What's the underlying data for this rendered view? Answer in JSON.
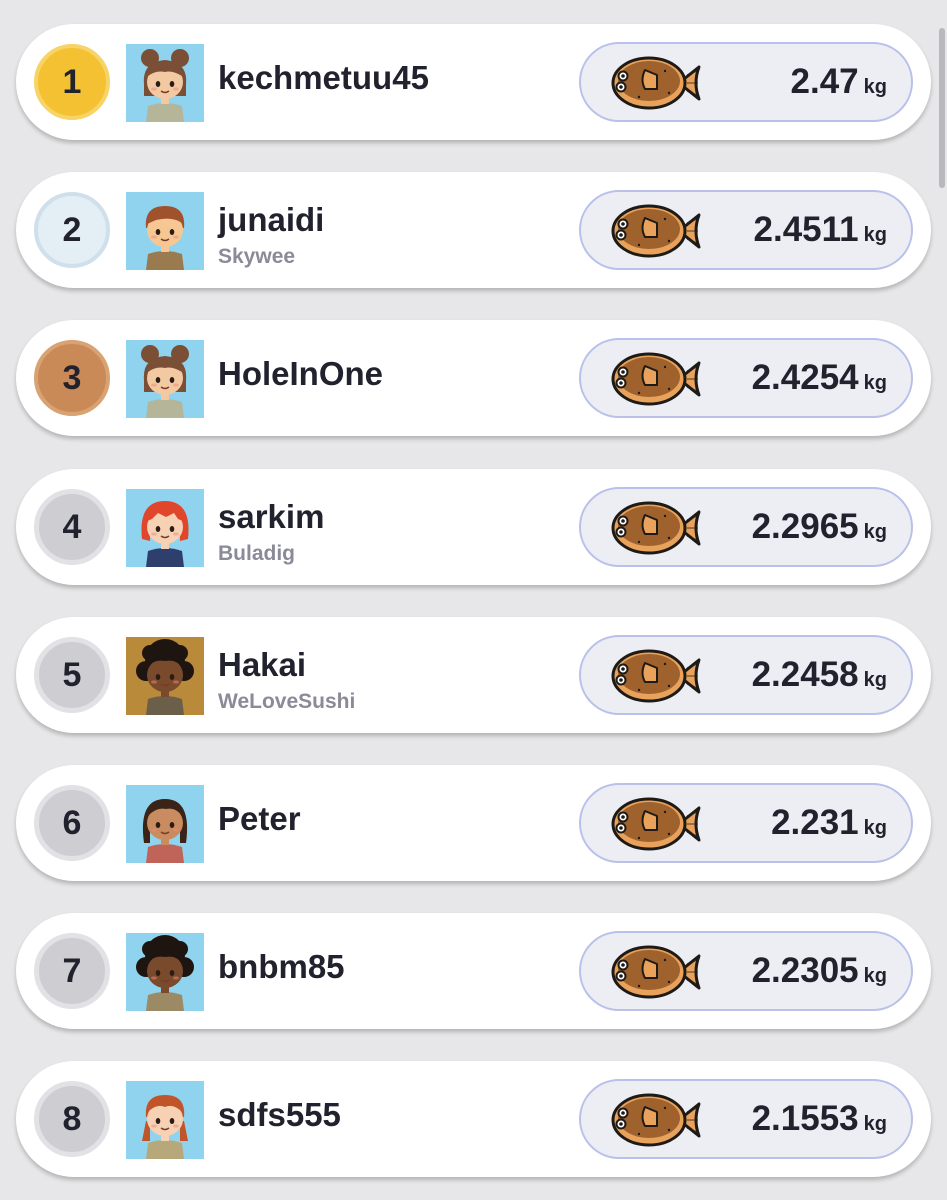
{
  "leaderboard": {
    "unit": "kg",
    "entries": [
      {
        "rank": "1",
        "medal": "gold",
        "username": "kechmetuu45",
        "island": "",
        "weight": "2.47",
        "avatar": {
          "skin": "#f3c9a2",
          "hair": "#7a4f35",
          "hair_style": "buns",
          "background": "#8fd3ee",
          "shirt": "#b5b59a"
        }
      },
      {
        "rank": "2",
        "medal": "silver",
        "username": "junaidi",
        "island": "Skywee",
        "weight": "2.4511",
        "avatar": {
          "skin": "#f6c792",
          "hair": "#a0522d",
          "hair_style": "short",
          "background": "#8fd3ee",
          "shirt": "#9a7b4f"
        }
      },
      {
        "rank": "3",
        "medal": "bronze",
        "username": "HoleInOne",
        "island": "",
        "weight": "2.4254",
        "avatar": {
          "skin": "#f3c9a2",
          "hair": "#7a4f35",
          "hair_style": "buns",
          "background": "#8fd3ee",
          "shirt": "#b5b59a"
        }
      },
      {
        "rank": "4",
        "medal": "plain",
        "username": "sarkim",
        "island": "Buladig",
        "weight": "2.2965",
        "avatar": {
          "skin": "#f6d1b4",
          "hair": "#e0462b",
          "hair_style": "bob",
          "background": "#8fd3ee",
          "shirt": "#2e3f6e"
        }
      },
      {
        "rank": "5",
        "medal": "plain",
        "username": "Hakai",
        "island": "WeLoveSushi",
        "weight": "2.2458",
        "avatar": {
          "skin": "#7a4a2c",
          "hair": "#1e1410",
          "hair_style": "curly",
          "background": "#b88a3a",
          "shirt": "#6b5f4a"
        }
      },
      {
        "rank": "6",
        "medal": "plain",
        "username": "Peter",
        "island": "",
        "weight": "2.231",
        "avatar": {
          "skin": "#c98b60",
          "hair": "#3a2418",
          "hair_style": "long",
          "background": "#8fd3ee",
          "shirt": "#c0645a"
        }
      },
      {
        "rank": "7",
        "medal": "plain",
        "username": "bnbm85",
        "island": "",
        "weight": "2.2305",
        "avatar": {
          "skin": "#7a4a2c",
          "hair": "#1e1410",
          "hair_style": "curly",
          "background": "#8fd3ee",
          "shirt": "#9b8a64"
        }
      },
      {
        "rank": "8",
        "medal": "plain",
        "username": "sdfs555",
        "island": "",
        "weight": "2.1553",
        "avatar": {
          "skin": "#f6d1b4",
          "hair": "#c0552a",
          "hair_style": "braids",
          "background": "#8fd3ee",
          "shirt": "#b7a87c"
        }
      }
    ]
  },
  "icons": {
    "fish": "flounder-fish-icon",
    "fish_colors": {
      "body": "#a0622c",
      "fin": "#e8a25c",
      "outline": "#1e1a16"
    }
  }
}
